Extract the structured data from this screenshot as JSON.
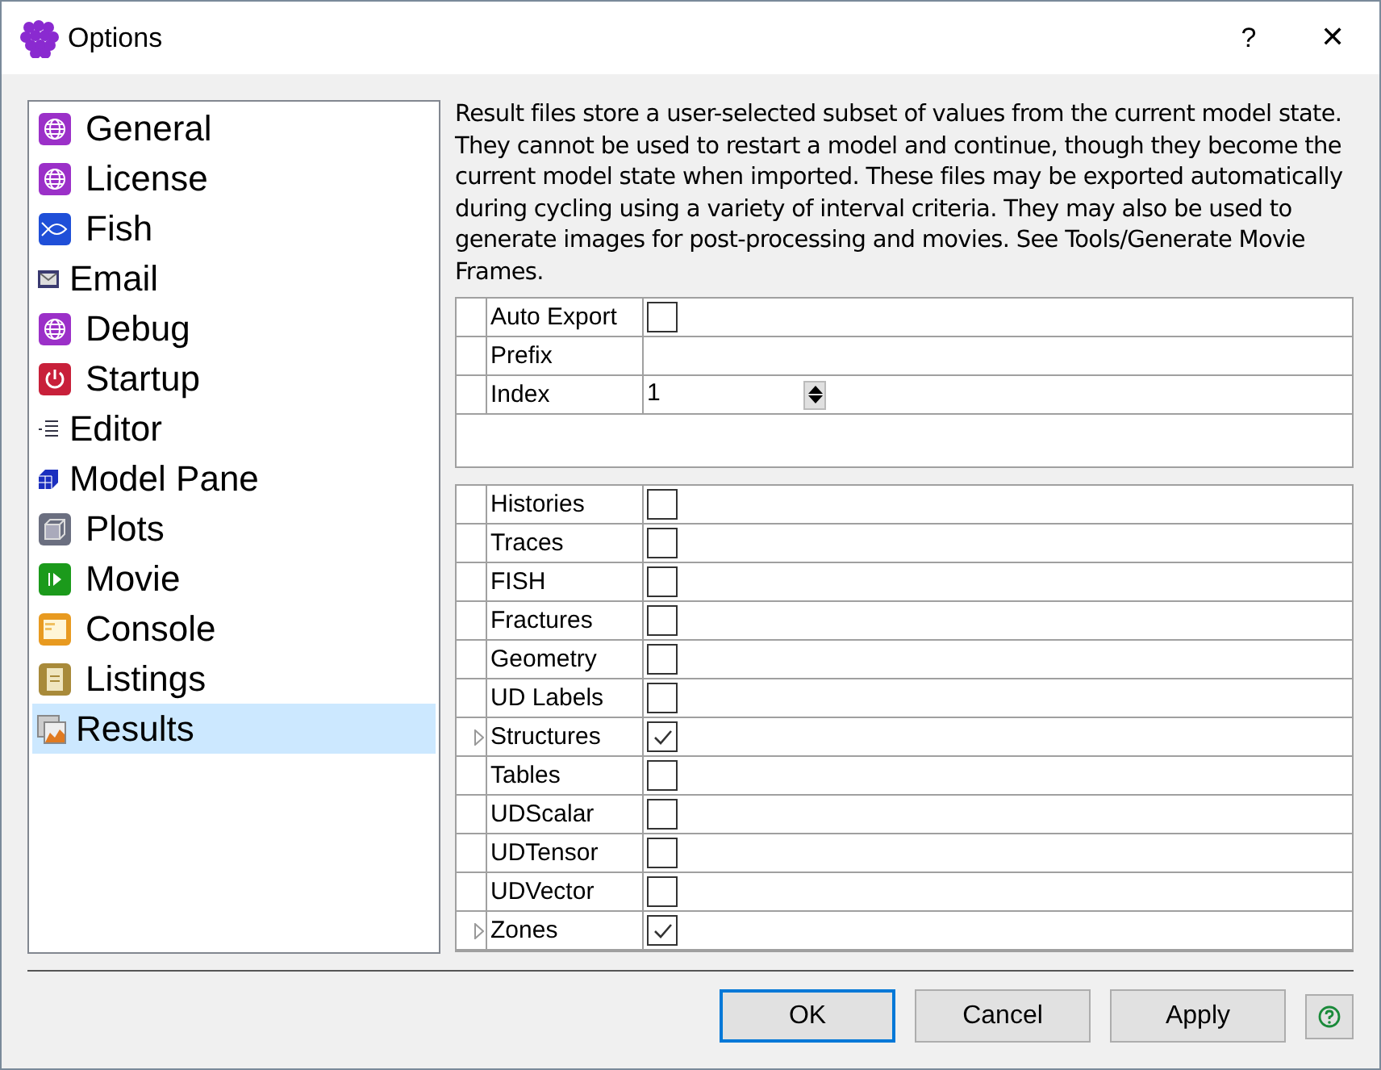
{
  "window": {
    "title": "Options",
    "help": "?",
    "close": "✕"
  },
  "sidebar": {
    "items": [
      {
        "label": "General",
        "selected": false
      },
      {
        "label": "License",
        "selected": false
      },
      {
        "label": "Fish",
        "selected": false
      },
      {
        "label": "Email",
        "selected": false
      },
      {
        "label": "Debug",
        "selected": false
      },
      {
        "label": "Startup",
        "selected": false
      },
      {
        "label": "Editor",
        "selected": false
      },
      {
        "label": "Model Pane",
        "selected": false
      },
      {
        "label": "Plots",
        "selected": false
      },
      {
        "label": "Movie",
        "selected": false
      },
      {
        "label": "Console",
        "selected": false
      },
      {
        "label": "Listings",
        "selected": false
      },
      {
        "label": "Results",
        "selected": true
      }
    ]
  },
  "description": "Result files store a user-selected subset of values from the current model state. They cannot be used to restart a model and continue, though they become the current model state when imported. These files may be exported automatically during cycling using a variety of interval criteria. They may also be used to generate images for post-processing and movies. See Tools/Generate Movie Frames.",
  "export_table": {
    "rows": [
      {
        "kind": "checkbox",
        "label": "Auto Export",
        "checked": false
      },
      {
        "kind": "text",
        "label": "Prefix"
      },
      {
        "kind": "spinner",
        "label": "Index",
        "value": "1"
      }
    ]
  },
  "items_table": {
    "rows": [
      {
        "label": "Histories",
        "checked": false,
        "expandable": false
      },
      {
        "label": "Traces",
        "checked": false,
        "expandable": false
      },
      {
        "label": "FISH",
        "checked": false,
        "expandable": false
      },
      {
        "label": "Fractures",
        "checked": false,
        "expandable": false
      },
      {
        "label": "Geometry",
        "checked": false,
        "expandable": false
      },
      {
        "label": "UD Labels",
        "checked": false,
        "expandable": false
      },
      {
        "label": "Structures",
        "checked": true,
        "expandable": true
      },
      {
        "label": "Tables",
        "checked": false,
        "expandable": false
      },
      {
        "label": "UDScalar",
        "checked": false,
        "expandable": false
      },
      {
        "label": "UDTensor",
        "checked": false,
        "expandable": false
      },
      {
        "label": "UDVector",
        "checked": false,
        "expandable": false
      },
      {
        "label": "Zones",
        "checked": true,
        "expandable": true
      }
    ]
  },
  "buttons": [
    {
      "label": "OK",
      "default": true
    },
    {
      "label": "Cancel",
      "default": false
    },
    {
      "label": "Apply",
      "default": false
    }
  ]
}
